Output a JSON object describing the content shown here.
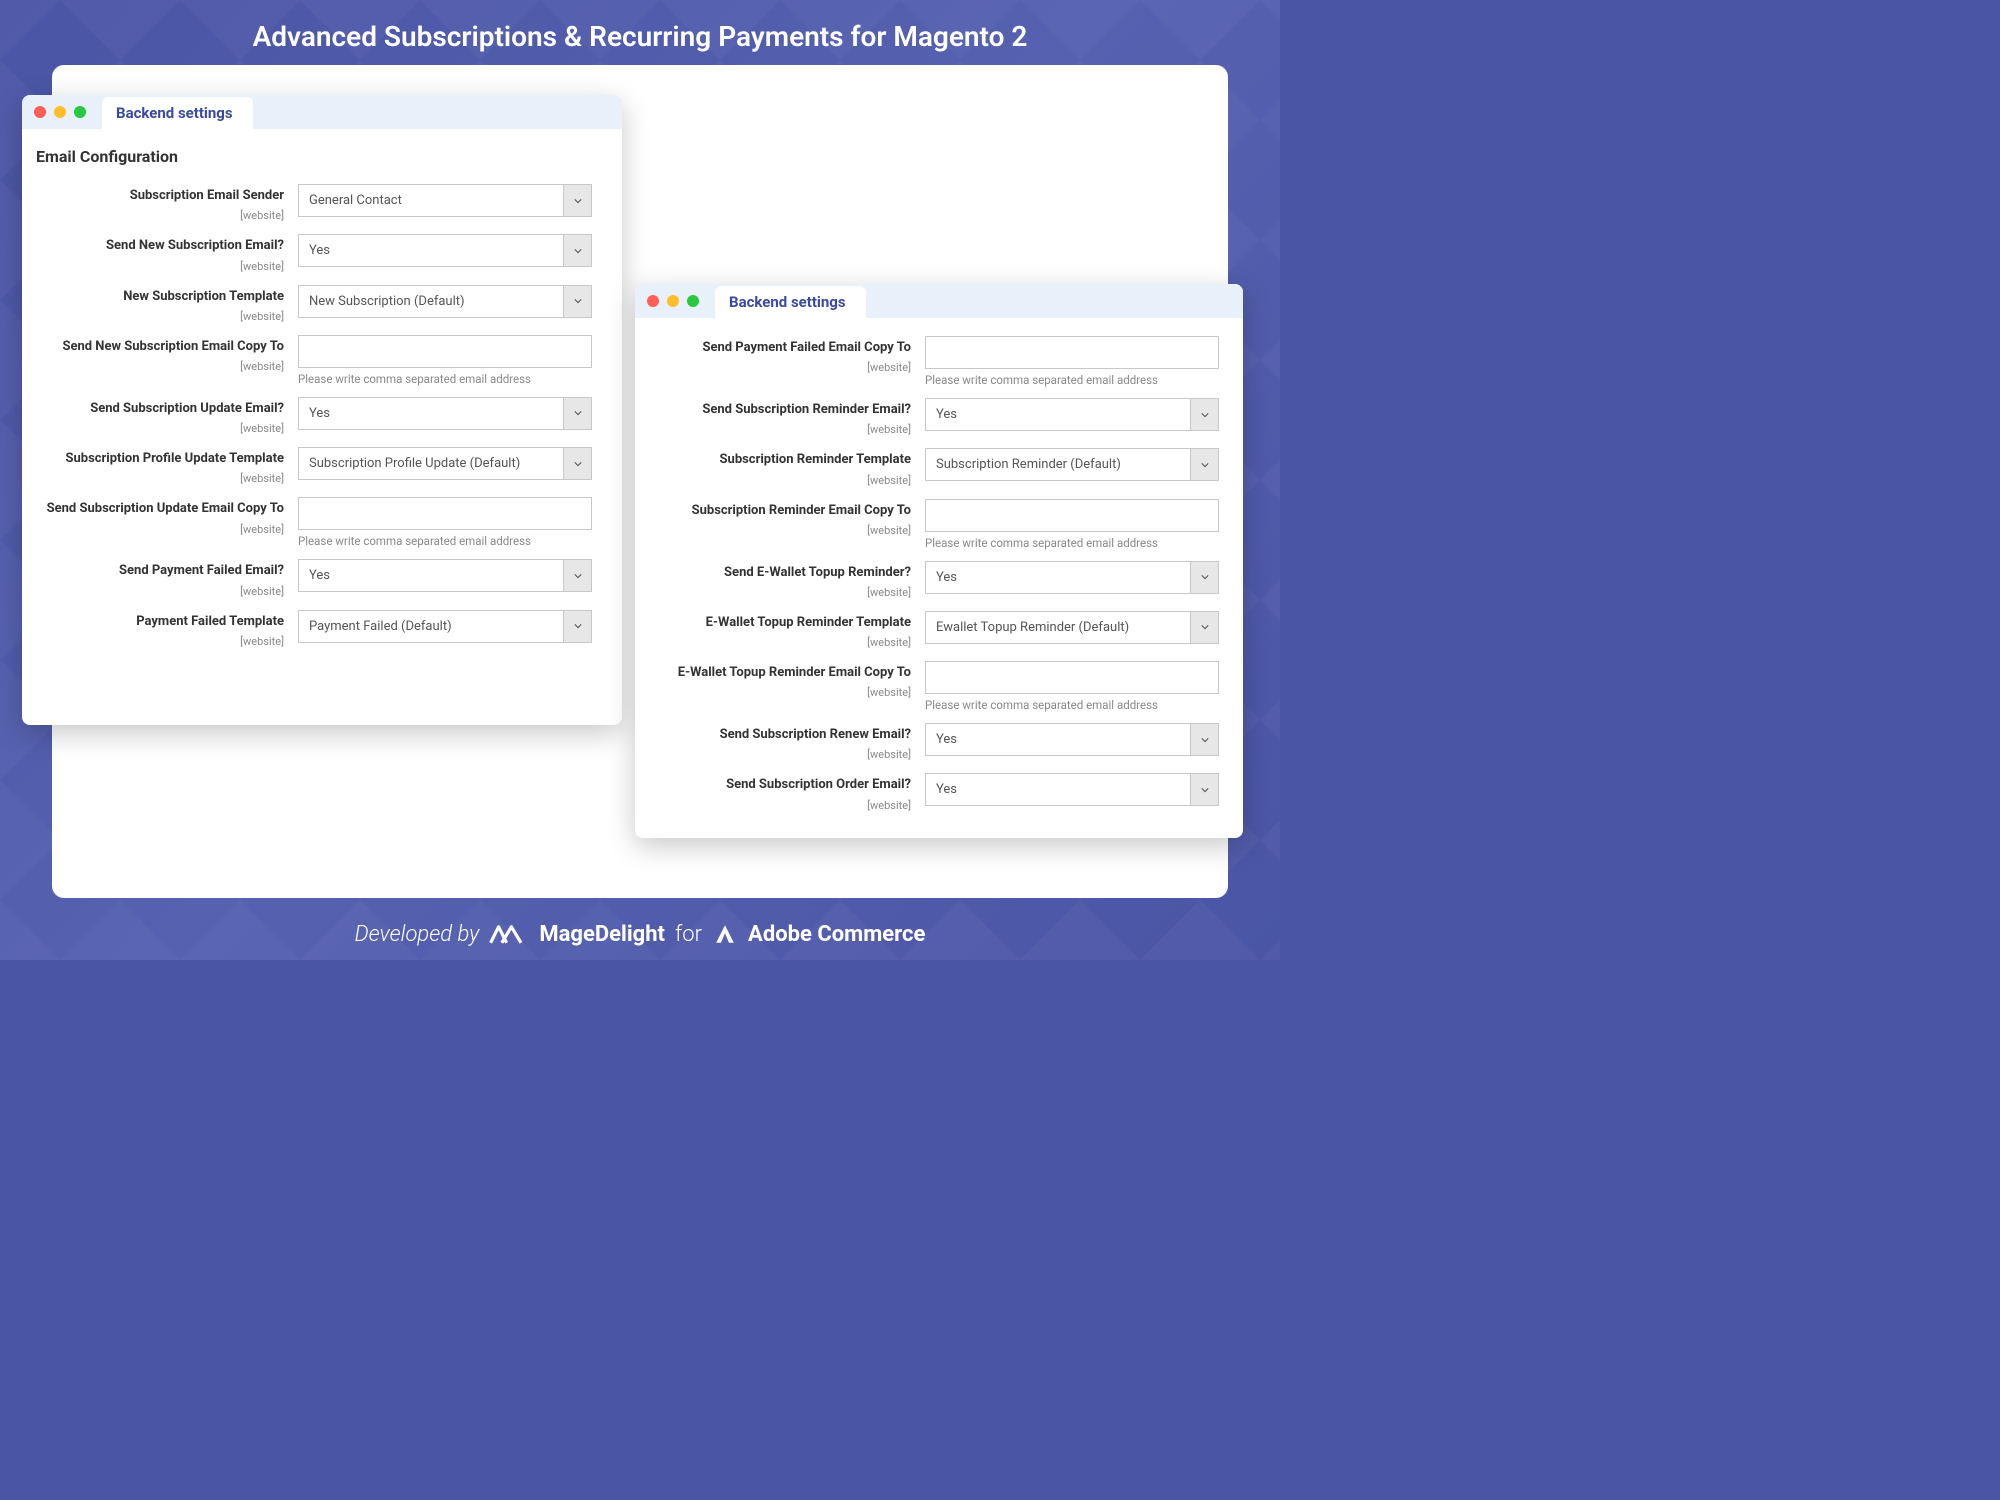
{
  "page": {
    "title": "Advanced Subscriptions & Recurring Payments for Magento 2"
  },
  "windowLeft": {
    "tab": "Backend settings",
    "section": "Email Configuration",
    "scope": "[website]",
    "hint": "Please write comma separated email address",
    "fields": {
      "sender": {
        "label": "Subscription Email Sender",
        "value": "General Contact"
      },
      "sendNew": {
        "label": "Send New Subscription Email?",
        "value": "Yes"
      },
      "newTemplate": {
        "label": "New Subscription Template",
        "value": "New Subscription (Default)"
      },
      "newCopy": {
        "label": "Send New Subscription Email Copy To",
        "value": ""
      },
      "sendUpdate": {
        "label": "Send Subscription Update Email?",
        "value": "Yes"
      },
      "updateTemplate": {
        "label": "Subscription Profile Update Template",
        "value": "Subscription Profile Update (Default)"
      },
      "updateCopy": {
        "label": "Send Subscription Update Email Copy To",
        "value": ""
      },
      "sendFailed": {
        "label": "Send Payment Failed Email?",
        "value": "Yes"
      },
      "failedTemplate": {
        "label": "Payment Failed Template",
        "value": "Payment Failed (Default)"
      }
    }
  },
  "windowRight": {
    "tab": "Backend settings",
    "scope": "[website]",
    "hint": "Please write comma separated email address",
    "fields": {
      "failedCopy": {
        "label": "Send Payment Failed Email Copy To",
        "value": ""
      },
      "sendReminder": {
        "label": "Send Subscription Reminder Email?",
        "value": "Yes"
      },
      "reminderTemplate": {
        "label": "Subscription Reminder Template",
        "value": "Subscription Reminder (Default)"
      },
      "reminderCopy": {
        "label": "Subscription Reminder Email Copy To",
        "value": ""
      },
      "sendTopup": {
        "label": "Send E-Wallet Topup Reminder?",
        "value": "Yes"
      },
      "topupTemplate": {
        "label": "E-Wallet Topup Reminder Template",
        "value": "Ewallet Topup Reminder (Default)"
      },
      "topupCopy": {
        "label": "E-Wallet Topup Reminder Email Copy To",
        "value": ""
      },
      "sendRenew": {
        "label": "Send Subscription Renew Email?",
        "value": "Yes"
      },
      "sendOrder": {
        "label": "Send Subscription Order Email?",
        "value": "Yes"
      }
    }
  },
  "footer": {
    "developed": "Developed by",
    "brand": "MageDelight",
    "for": "for",
    "adobe": "Adobe Commerce"
  }
}
